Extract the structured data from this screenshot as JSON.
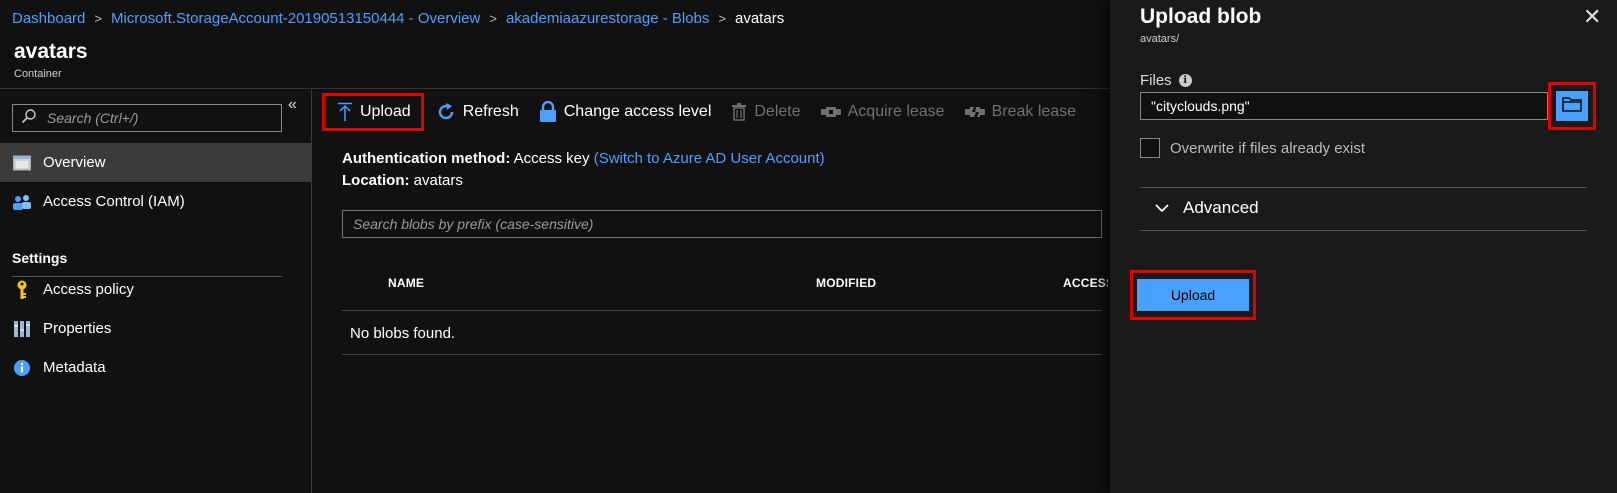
{
  "breadcrumb": [
    {
      "label": "Dashboard"
    },
    {
      "label": "Microsoft.StorageAccount-20190513150444 - Overview"
    },
    {
      "label": "akademiaazurestorage - Blobs"
    },
    {
      "label": "avatars"
    }
  ],
  "page": {
    "title": "avatars",
    "subtitle": "Container"
  },
  "sidebar": {
    "collapse_glyph": "«",
    "search_placeholder": "Search (Ctrl+/)",
    "items": [
      {
        "label": "Overview",
        "icon": "overview-icon",
        "active": true
      },
      {
        "label": "Access Control (IAM)",
        "icon": "iam-icon"
      }
    ],
    "section_header": "Settings",
    "settings_items": [
      {
        "label": "Access policy",
        "icon": "key-icon"
      },
      {
        "label": "Properties",
        "icon": "properties-icon"
      },
      {
        "label": "Metadata",
        "icon": "info-icon"
      }
    ]
  },
  "toolbar": {
    "upload": "Upload",
    "refresh": "Refresh",
    "change_access": "Change access level",
    "delete": "Delete",
    "acquire_lease": "Acquire lease",
    "break_lease": "Break lease"
  },
  "main": {
    "auth_label": "Authentication method:",
    "auth_value": "Access key",
    "auth_link": "(Switch to Azure AD User Account)",
    "location_label": "Location:",
    "location_value": "avatars",
    "search_placeholder": "Search blobs by prefix (case-sensitive)",
    "columns": [
      "NAME",
      "MODIFIED",
      "ACCESS"
    ],
    "empty_message": "No blobs found."
  },
  "panel": {
    "title": "Upload blob",
    "subtitle": "avatars/",
    "close_glyph": "✕",
    "files_label": "Files",
    "files_value": "\"cityclouds.png\"",
    "overwrite_label": "Overwrite if files already exist",
    "advanced_label": "Advanced",
    "upload_button": "Upload"
  },
  "colors": {
    "accent": "#4aa0ff",
    "highlight": "#e00000",
    "background": "#111111",
    "panel_background": "#1a1a1a",
    "active_nav": "#3b3b3b"
  }
}
